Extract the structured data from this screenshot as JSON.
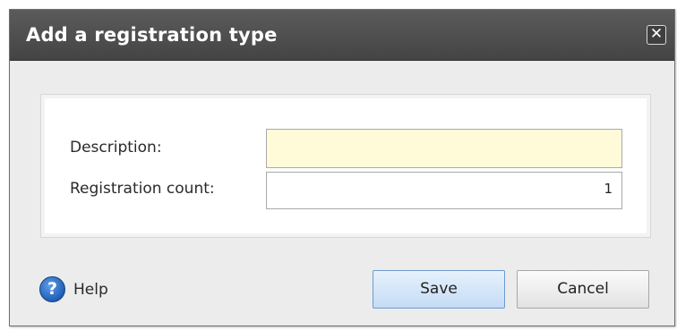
{
  "dialog": {
    "title": "Add a registration type",
    "close_icon": "close-icon",
    "close_glyph": "✕"
  },
  "form": {
    "description": {
      "label": "Description:",
      "value": ""
    },
    "registration_count": {
      "label": "Registration count:",
      "value": "1"
    }
  },
  "footer": {
    "help_icon": "help-icon",
    "help_glyph": "?",
    "help_label": "Help",
    "save_label": "Save",
    "cancel_label": "Cancel"
  },
  "colors": {
    "titlebar": "#4f4f4f",
    "dialog_body": "#ececec",
    "required_field": "#fffbd9",
    "save_button": "#c5dcf5",
    "help_icon": "#1f5fb8"
  }
}
